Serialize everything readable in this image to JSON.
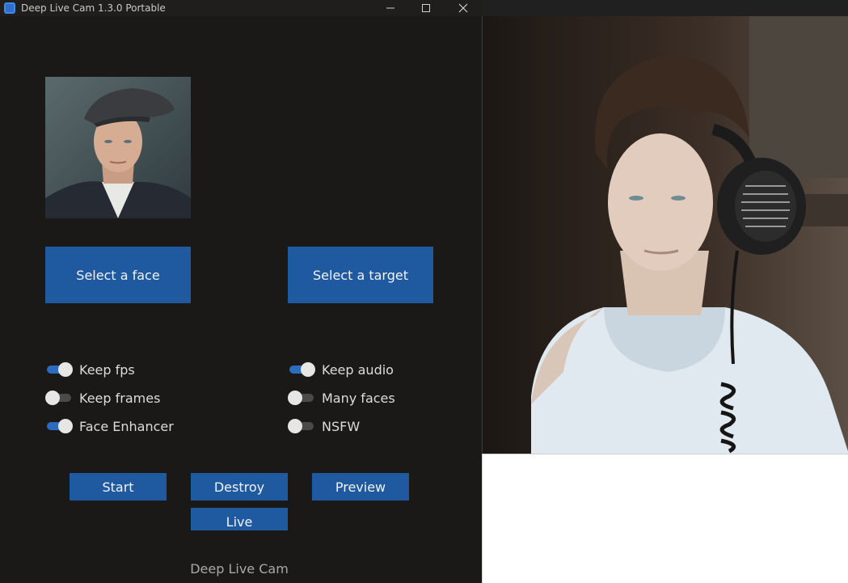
{
  "window": {
    "title": "Deep Live Cam 1.3.0 Portable",
    "controls": {
      "minimize": "minimize-icon",
      "maximize": "maximize-icon",
      "close": "close-icon"
    }
  },
  "source_face": {
    "image": "source-face-thumbnail"
  },
  "buttons": {
    "select_face": "Select a face",
    "select_target": "Select a target",
    "start": "Start",
    "destroy": "Destroy",
    "preview": "Preview",
    "live": "Live"
  },
  "options": {
    "keep_fps": {
      "label": "Keep fps",
      "enabled": true
    },
    "keep_frames": {
      "label": "Keep frames",
      "enabled": false
    },
    "face_enhancer": {
      "label": "Face Enhancer",
      "enabled": true
    },
    "keep_audio": {
      "label": "Keep audio",
      "enabled": true
    },
    "many_faces": {
      "label": "Many faces",
      "enabled": false
    },
    "nsfw": {
      "label": "NSFW",
      "enabled": false
    }
  },
  "footer": {
    "label": "Deep Live Cam"
  },
  "preview": {
    "image": "live-preview-frame"
  },
  "colors": {
    "window_bg": "#1a1918",
    "accent": "#1f5aa0",
    "switch_on": "#2b6cbf",
    "switch_off": "#4a4a4a"
  }
}
